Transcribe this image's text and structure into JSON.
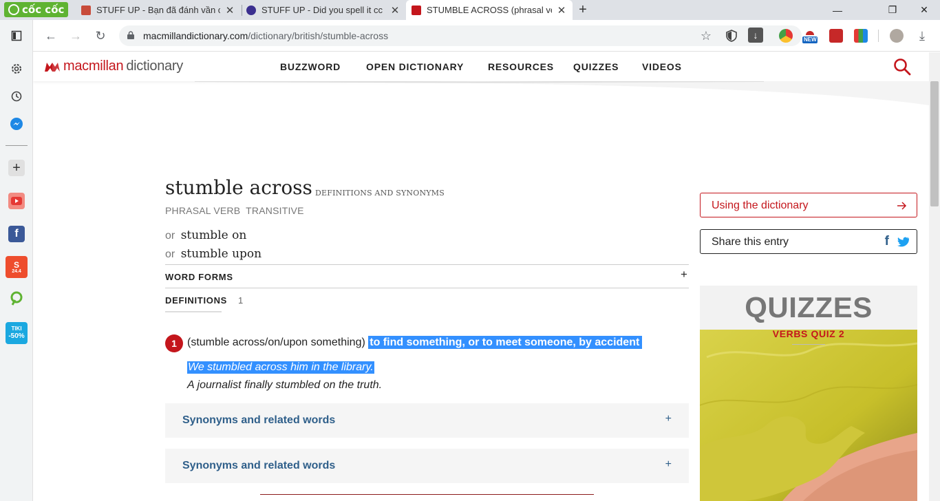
{
  "browser": {
    "brand": "cốc cốc",
    "tabs": [
      {
        "title": "STUFF UP - Bạn đã đánh vần c",
        "active": false
      },
      {
        "title": "STUFF UP - Did you spell it cc",
        "active": false
      },
      {
        "title": "STUMBLE ACROSS (phrasal ve",
        "active": true
      }
    ],
    "url_host": "macmillandictionary.com",
    "url_path": "/dictionary/british/stumble-across",
    "ext_new_badge": "NEW",
    "sidebar_tiki": "TIKI",
    "sidebar_tiki_discount": "-50%",
    "sidebar_shopee_date": "24.4"
  },
  "site": {
    "logo_part1": "macmillan",
    "logo_part2": "dictionary",
    "nav": [
      "BUZZWORD",
      "OPEN DICTIONARY",
      "RESOURCES",
      "QUIZZES",
      "VIDEOS"
    ]
  },
  "entry": {
    "headword": "stumble across",
    "subtitle": "DEFINITIONS AND SYNONYMS",
    "part_of_speech": "PHRASAL VERB  TRANSITIVE",
    "variants": [
      {
        "or": "or",
        "word": "stumble on"
      },
      {
        "or": "or",
        "word": "stumble upon"
      }
    ],
    "word_forms_label": "WORD FORMS",
    "definitions_label": "DEFINITIONS",
    "definitions_count": "1",
    "sense": {
      "number": "1",
      "pattern": "(stumble across/on/upon something)",
      "definition": "to find something, or to meet someone, by accident",
      "examples": [
        "We stumbled across him in the library.",
        "A journalist finally stumbled on the truth."
      ]
    },
    "synonym_boxes": [
      "Synonyms and related words",
      "Synonyms and related words"
    ]
  },
  "sidebar_right": {
    "using_dictionary": "Using the dictionary",
    "share_entry": "Share this entry",
    "quiz_heading": "QUIZZES",
    "quiz_name": "VERBS QUIZ 2"
  },
  "colors": {
    "brand_red": "#c4161c",
    "link_blue": "#2f5f8a",
    "selection": "#3390ff"
  }
}
